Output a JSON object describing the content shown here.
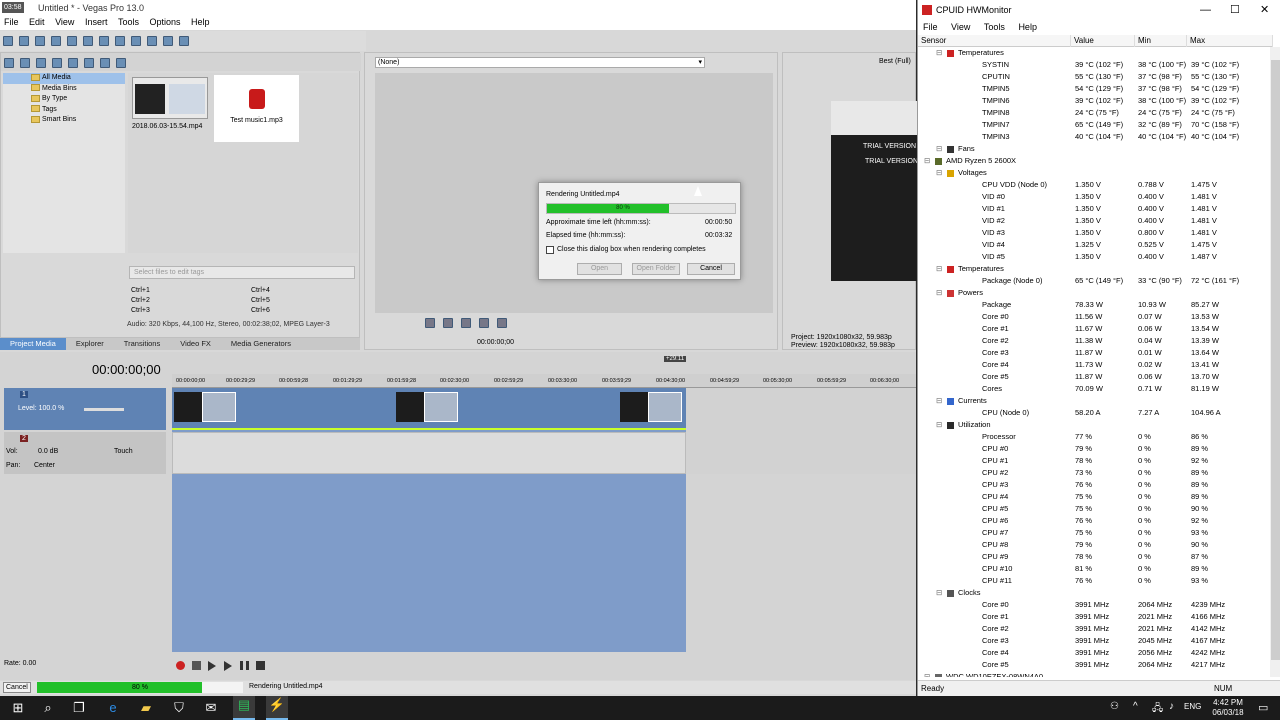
{
  "vegas": {
    "title": "Untitled * - Vegas Pro 13.0",
    "clock_badge": "03:58",
    "menu": [
      "File",
      "Edit",
      "View",
      "Insert",
      "Tools",
      "Options",
      "Help"
    ],
    "media_tree": [
      "All Media",
      "Media Bins",
      "By Type",
      "Tags",
      "Smart Bins"
    ],
    "media_files": [
      {
        "name": "2018.06.03-15.54.mp4"
      },
      {
        "name": "Test music1.mp3"
      }
    ],
    "filter_placeholder": "Select files to edit tags",
    "shortcuts": [
      "Ctrl+1",
      "Ctrl+4",
      "Ctrl+2",
      "Ctrl+5",
      "Ctrl+3",
      "Ctrl+6"
    ],
    "media_info": "Audio: 320 Kbps, 44,100 Hz, Stereo, 00:02:38;02, MPEG Layer-3",
    "tabs": [
      "Project Media",
      "Explorer",
      "Transitions",
      "Video FX",
      "Media Generators"
    ],
    "trimmer_select": "(None)",
    "trimmer_time": "00:00:00;00",
    "preview_quality": "Best (Full)",
    "preview_overlay": [
      "TRIAL VERSION",
      "TRIAL VERSION"
    ],
    "project_info": "Project:  1920x1080x32, 59.983p",
    "preview_info": "Preview:  1920x1080x32, 59.983p",
    "timecode": "00:00:00;00",
    "loop_marker": "+29:11",
    "ruler": [
      "00:00:00;00",
      "00:00:29;29",
      "00:00:59;28",
      "00:01:29;29",
      "00:01:59;28",
      "00:02:30;00",
      "00:02:59;29",
      "00:03:30;00",
      "00:03:59;29",
      "00:04:30;00",
      "00:04:59;29",
      "00:05:30;00",
      "00:05:59;29",
      "00:06:30;00"
    ],
    "video_track": {
      "number": "1",
      "level": "Level: 100.0 %"
    },
    "audio_track": {
      "number": "2",
      "vol": "Vol:",
      "vol_value": "0.0 dB",
      "touch": "Touch",
      "pan": "Pan:",
      "pan_value": "Center"
    },
    "rate": "Rate: 0.00",
    "status_cancel": "Cancel",
    "status_progress_text": "80 %",
    "status_progress": 0.8,
    "status_text": "Rendering Untitled.mp4"
  },
  "dialog": {
    "title": "Rendering Untitled.mp4",
    "progress_text": "80 %",
    "progress": 0.8,
    "approx_label": "Approximate time left (hh:mm:ss):",
    "approx_value": "00:00:50",
    "elapsed_label": "Elapsed time (hh:mm:ss):",
    "elapsed_value": "00:03:32",
    "checkbox_label": "Close this dialog box when rendering completes",
    "open": "Open",
    "open_folder": "Open Folder",
    "cancel": "Cancel"
  },
  "hwmonitor": {
    "title": "CPUID HWMonitor",
    "menu": [
      "File",
      "View",
      "Tools",
      "Help"
    ],
    "columns": [
      "Sensor",
      "Value",
      "Min",
      "Max"
    ],
    "rows": [
      {
        "indent": 2,
        "kind": "group",
        "name": "Temperatures",
        "icon": "flame-icon"
      },
      {
        "indent": 3,
        "name": "SYSTIN",
        "value": "39 °C  (102 °F)",
        "min": "38 °C  (100 °F)",
        "max": "39 °C  (102 °F)"
      },
      {
        "indent": 3,
        "name": "CPUTIN",
        "value": "55 °C  (130 °F)",
        "min": "37 °C  (98 °F)",
        "max": "55 °C  (130 °F)"
      },
      {
        "indent": 3,
        "name": "TMPIN5",
        "value": "54 °C  (129 °F)",
        "min": "37 °C  (98 °F)",
        "max": "54 °C  (129 °F)"
      },
      {
        "indent": 3,
        "name": "TMPIN6",
        "value": "39 °C  (102 °F)",
        "min": "38 °C  (100 °F)",
        "max": "39 °C  (102 °F)"
      },
      {
        "indent": 3,
        "name": "TMPIN8",
        "value": "24 °C  (75 °F)",
        "min": "24 °C  (75 °F)",
        "max": "24 °C  (75 °F)"
      },
      {
        "indent": 3,
        "name": "TMPIN7",
        "value": "65 °C  (149 °F)",
        "min": "32 °C  (89 °F)",
        "max": "70 °C  (158 °F)"
      },
      {
        "indent": 3,
        "name": "TMPIN3",
        "value": "40 °C  (104 °F)",
        "min": "40 °C  (104 °F)",
        "max": "40 °C  (104 °F)"
      },
      {
        "indent": 2,
        "kind": "group",
        "name": "Fans",
        "icon": "fan-icon"
      },
      {
        "indent": 1,
        "kind": "group",
        "name": "AMD Ryzen 5 2600X",
        "icon": "chip-icon"
      },
      {
        "indent": 2,
        "kind": "group",
        "name": "Voltages",
        "icon": "voltage-icon"
      },
      {
        "indent": 3,
        "name": "CPU VDD (Node 0)",
        "value": "1.350 V",
        "min": "0.788 V",
        "max": "1.475 V"
      },
      {
        "indent": 3,
        "name": "VID #0",
        "value": "1.350 V",
        "min": "0.400 V",
        "max": "1.481 V"
      },
      {
        "indent": 3,
        "name": "VID #1",
        "value": "1.350 V",
        "min": "0.400 V",
        "max": "1.481 V"
      },
      {
        "indent": 3,
        "name": "VID #2",
        "value": "1.350 V",
        "min": "0.400 V",
        "max": "1.481 V"
      },
      {
        "indent": 3,
        "name": "VID #3",
        "value": "1.350 V",
        "min": "0.800 V",
        "max": "1.481 V"
      },
      {
        "indent": 3,
        "name": "VID #4",
        "value": "1.325 V",
        "min": "0.525 V",
        "max": "1.475 V"
      },
      {
        "indent": 3,
        "name": "VID #5",
        "value": "1.350 V",
        "min": "0.400 V",
        "max": "1.487 V"
      },
      {
        "indent": 2,
        "kind": "group",
        "name": "Temperatures",
        "icon": "flame-icon"
      },
      {
        "indent": 3,
        "name": "Package (Node 0)",
        "value": "65 °C  (149 °F)",
        "min": "33 °C  (90 °F)",
        "max": "72 °C  (161 °F)"
      },
      {
        "indent": 2,
        "kind": "group",
        "name": "Powers",
        "icon": "power-icon"
      },
      {
        "indent": 3,
        "name": "Package",
        "value": "78.33 W",
        "min": "10.93 W",
        "max": "85.27 W"
      },
      {
        "indent": 3,
        "name": "Core #0",
        "value": "11.56 W",
        "min": "0.07 W",
        "max": "13.53 W"
      },
      {
        "indent": 3,
        "name": "Core #1",
        "value": "11.67 W",
        "min": "0.06 W",
        "max": "13.54 W"
      },
      {
        "indent": 3,
        "name": "Core #2",
        "value": "11.38 W",
        "min": "0.04 W",
        "max": "13.39 W"
      },
      {
        "indent": 3,
        "name": "Core #3",
        "value": "11.87 W",
        "min": "0.01 W",
        "max": "13.64 W"
      },
      {
        "indent": 3,
        "name": "Core #4",
        "value": "11.73 W",
        "min": "0.02 W",
        "max": "13.41 W"
      },
      {
        "indent": 3,
        "name": "Core #5",
        "value": "11.87 W",
        "min": "0.06 W",
        "max": "13.70 W"
      },
      {
        "indent": 3,
        "name": "Cores",
        "value": "70.09 W",
        "min": "0.71 W",
        "max": "81.19 W"
      },
      {
        "indent": 2,
        "kind": "group",
        "name": "Currents",
        "icon": "current-icon"
      },
      {
        "indent": 3,
        "name": "CPU (Node 0)",
        "value": "58.20 A",
        "min": "7.27 A",
        "max": "104.96 A"
      },
      {
        "indent": 2,
        "kind": "group",
        "name": "Utilization",
        "icon": "utilization-icon"
      },
      {
        "indent": 3,
        "name": "Processor",
        "value": "77 %",
        "min": "0 %",
        "max": "86 %"
      },
      {
        "indent": 3,
        "name": "CPU #0",
        "value": "79 %",
        "min": "0 %",
        "max": "89 %"
      },
      {
        "indent": 3,
        "name": "CPU #1",
        "value": "78 %",
        "min": "0 %",
        "max": "92 %"
      },
      {
        "indent": 3,
        "name": "CPU #2",
        "value": "73 %",
        "min": "0 %",
        "max": "89 %"
      },
      {
        "indent": 3,
        "name": "CPU #3",
        "value": "76 %",
        "min": "0 %",
        "max": "89 %"
      },
      {
        "indent": 3,
        "name": "CPU #4",
        "value": "75 %",
        "min": "0 %",
        "max": "89 %"
      },
      {
        "indent": 3,
        "name": "CPU #5",
        "value": "75 %",
        "min": "0 %",
        "max": "90 %"
      },
      {
        "indent": 3,
        "name": "CPU #6",
        "value": "76 %",
        "min": "0 %",
        "max": "92 %"
      },
      {
        "indent": 3,
        "name": "CPU #7",
        "value": "75 %",
        "min": "0 %",
        "max": "93 %"
      },
      {
        "indent": 3,
        "name": "CPU #8",
        "value": "79 %",
        "min": "0 %",
        "max": "90 %"
      },
      {
        "indent": 3,
        "name": "CPU #9",
        "value": "78 %",
        "min": "0 %",
        "max": "87 %"
      },
      {
        "indent": 3,
        "name": "CPU #10",
        "value": "81 %",
        "min": "0 %",
        "max": "89 %"
      },
      {
        "indent": 3,
        "name": "CPU #11",
        "value": "76 %",
        "min": "0 %",
        "max": "93 %"
      },
      {
        "indent": 2,
        "kind": "group",
        "name": "Clocks",
        "icon": "clock-icon"
      },
      {
        "indent": 3,
        "name": "Core #0",
        "value": "3991 MHz",
        "min": "2064 MHz",
        "max": "4239 MHz"
      },
      {
        "indent": 3,
        "name": "Core #1",
        "value": "3991 MHz",
        "min": "2021 MHz",
        "max": "4166 MHz"
      },
      {
        "indent": 3,
        "name": "Core #2",
        "value": "3991 MHz",
        "min": "2021 MHz",
        "max": "4142 MHz"
      },
      {
        "indent": 3,
        "name": "Core #3",
        "value": "3991 MHz",
        "min": "2045 MHz",
        "max": "4167 MHz"
      },
      {
        "indent": 3,
        "name": "Core #4",
        "value": "3991 MHz",
        "min": "2056 MHz",
        "max": "4242 MHz"
      },
      {
        "indent": 3,
        "name": "Core #5",
        "value": "3991 MHz",
        "min": "2064 MHz",
        "max": "4217 MHz"
      },
      {
        "indent": 1,
        "kind": "group",
        "name": "WDC WD10EZEX-08WN4A0",
        "icon": "disk-icon"
      }
    ],
    "status": "Ready",
    "num": "NUM"
  },
  "taskbar": {
    "time": "4:42 PM",
    "date": "06/03/18",
    "lang": "ENG",
    "icons": [
      "windows-start-icon",
      "search-icon",
      "task-view-icon",
      "edge-icon",
      "file-explorer-icon",
      "store-icon",
      "mail-icon",
      "vegas-icon",
      "hwmonitor-icon"
    ]
  },
  "colors": {
    "progress": "#22c02a",
    "accent": "#5b8ecb",
    "track": "#5f83b4",
    "hw_red": "#cc2222"
  }
}
